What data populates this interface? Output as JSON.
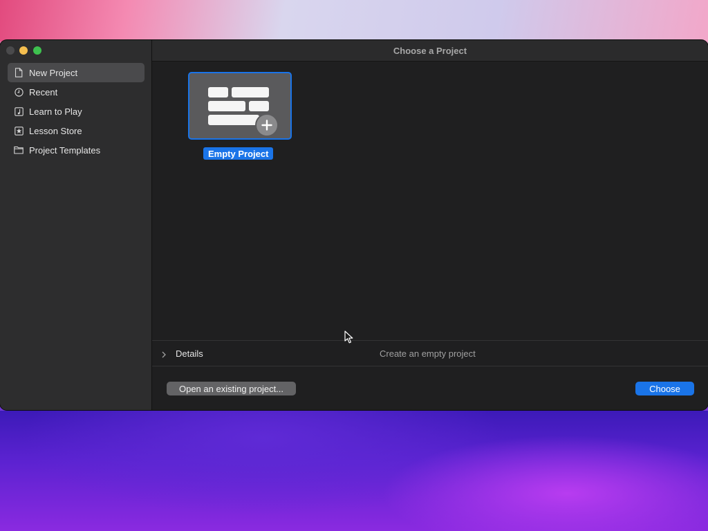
{
  "window": {
    "title": "Choose a Project"
  },
  "sidebar": {
    "items": [
      {
        "label": "New Project",
        "icon": "document-icon",
        "selected": true
      },
      {
        "label": "Recent",
        "icon": "clock-icon",
        "selected": false
      },
      {
        "label": "Learn to Play",
        "icon": "music-note-icon",
        "selected": false
      },
      {
        "label": "Lesson Store",
        "icon": "star-icon",
        "selected": false
      },
      {
        "label": "Project Templates",
        "icon": "folder-icon",
        "selected": false
      }
    ]
  },
  "main": {
    "templates": [
      {
        "label": "Empty Project",
        "icon": "bricks-plus-icon",
        "selected": true
      }
    ],
    "details": {
      "label": "Details",
      "description": "Create an empty project"
    }
  },
  "footer": {
    "open_label": "Open an existing project...",
    "choose_label": "Choose"
  },
  "colors": {
    "accent": "#1a74e8",
    "window_bg": "#1e1e1e",
    "sidebar_bg": "#2d2d2e"
  }
}
